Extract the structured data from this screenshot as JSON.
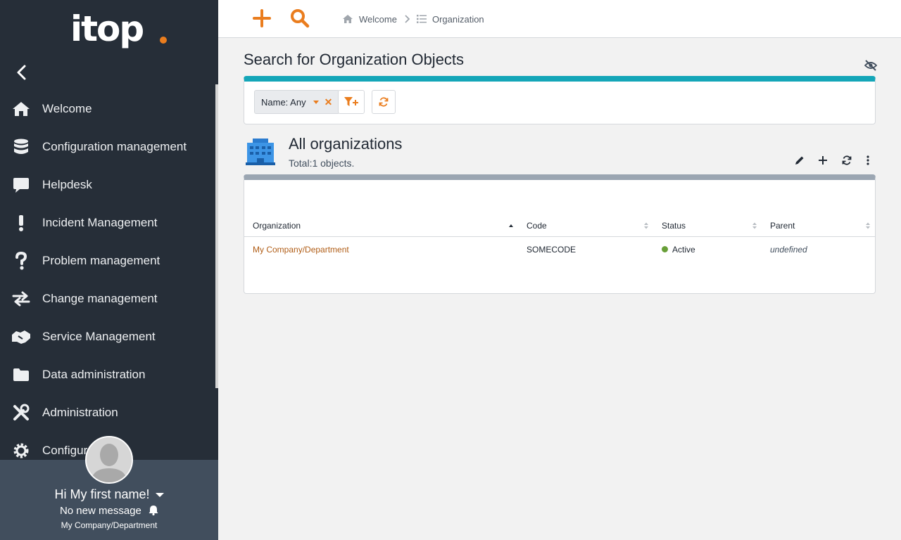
{
  "app": {
    "logo_text": "itop",
    "brand_color": "#ea7d1e",
    "sidebar_color": "#262e38"
  },
  "sidebar": {
    "items": [
      {
        "label": "Welcome",
        "icon": "home-icon"
      },
      {
        "label": "Configuration management",
        "icon": "database-icon"
      },
      {
        "label": "Helpdesk",
        "icon": "speech-bubble-icon"
      },
      {
        "label": "Incident Management",
        "icon": "exclamation-icon"
      },
      {
        "label": "Problem management",
        "icon": "question-icon"
      },
      {
        "label": "Change management",
        "icon": "exchange-icon"
      },
      {
        "label": "Service Management",
        "icon": "handshake-icon"
      },
      {
        "label": "Data administration",
        "icon": "folder-icon"
      },
      {
        "label": "Administration",
        "icon": "tools-icon"
      },
      {
        "label": "Configur",
        "icon": "gear-icon"
      }
    ]
  },
  "user": {
    "greeting": "Hi My first name!",
    "messages": "No new message",
    "organization": "My Company/Department"
  },
  "topbar": {
    "breadcrumb": [
      {
        "label": "Welcome",
        "icon": "home-icon"
      },
      {
        "label": "Organization",
        "icon": "list-icon"
      }
    ]
  },
  "search": {
    "title": "Search for Organization Objects",
    "criterion_label": "Name: Any",
    "accent_color": "#14a6b8"
  },
  "results": {
    "title": "All organizations",
    "count": "Total:1 objects.",
    "columns": [
      "Organization",
      "Code",
      "Status",
      "Parent"
    ],
    "rows": [
      {
        "organization": "My Company/Department",
        "code": "SOMECODE",
        "status": "Active",
        "parent": "undefined"
      }
    ]
  }
}
